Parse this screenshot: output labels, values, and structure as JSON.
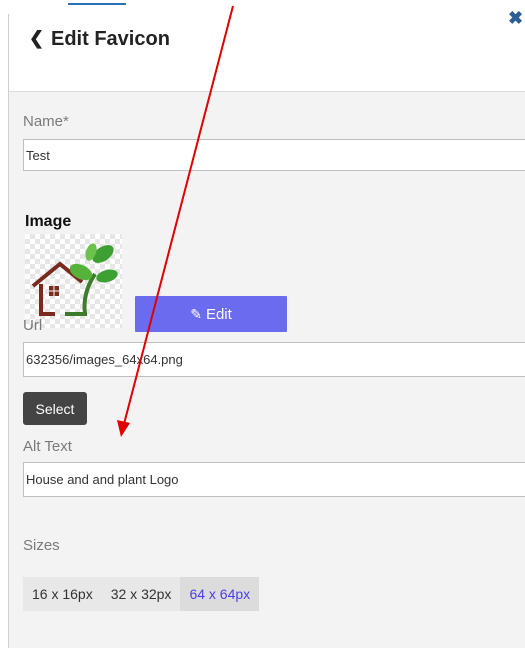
{
  "header": {
    "title": "Edit Favicon",
    "back_icon": "chevron-left-icon",
    "close_icon": "close-icon"
  },
  "form": {
    "name_label": "Name*",
    "name_value": "Test",
    "image_heading": "Image",
    "edit_label": "Edit",
    "edit_icon": "pencil-icon",
    "url_label": "Url",
    "url_value": "632356/images_64x64.png",
    "select_label": "Select",
    "alt_label": "Alt Text",
    "alt_value": "House and and plant Logo",
    "sizes_label": "Sizes",
    "sizes": [
      {
        "label": "16 x 16px",
        "active": false
      },
      {
        "label": "32 x 32px",
        "active": false
      },
      {
        "label": "64 x 64px",
        "active": true
      }
    ]
  },
  "colors": {
    "accent": "#6b6bf0",
    "arrow": "#e00000",
    "active_size_text": "#4b3ee8",
    "close_icon": "#2d5f96"
  }
}
